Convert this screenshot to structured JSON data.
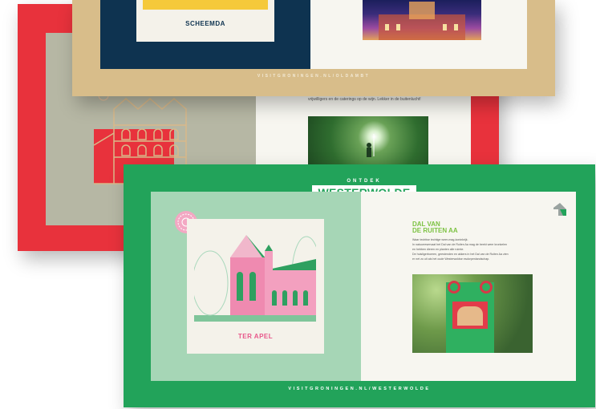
{
  "red_card": {
    "body_text": "vrijwilligers en de caterings op de wijn. Lekker in de buitenlucht!",
    "accent_color": "#e8323c"
  },
  "tan_card": {
    "photo_label": "SCHEEMDA",
    "footer_url": "VISITGRONINGEN.NL/OLDAMBT",
    "accent_color": "#d8bd8a"
  },
  "green_card": {
    "badge_top": "ONTDEK",
    "badge_main": "WESTERWOLDE",
    "photo_caption": "TER APEL",
    "right_title_line1": "DAL VAN",
    "right_title_line2": "DE RUITEN AA",
    "right_body": [
      "Waar techtise techtige weer-mag-koninkrijk.",
      "In natuurreservaat het Dal van de Ruiten Aa mag de beekt weer kronkelen",
      "en hebben dieren en planten alle ruimte.",
      "De huisligerboeren, geestenden en akkers in het Dal van de Ruiten Aa zien",
      "er net zo uit als het oude Westerwoldse esdorpenlandschap."
    ],
    "footer_url": "VISITGRONINGEN.NL/WESTERWOLDE",
    "accent_color": "#22a35a",
    "corner_icon": "arrow-icon"
  }
}
